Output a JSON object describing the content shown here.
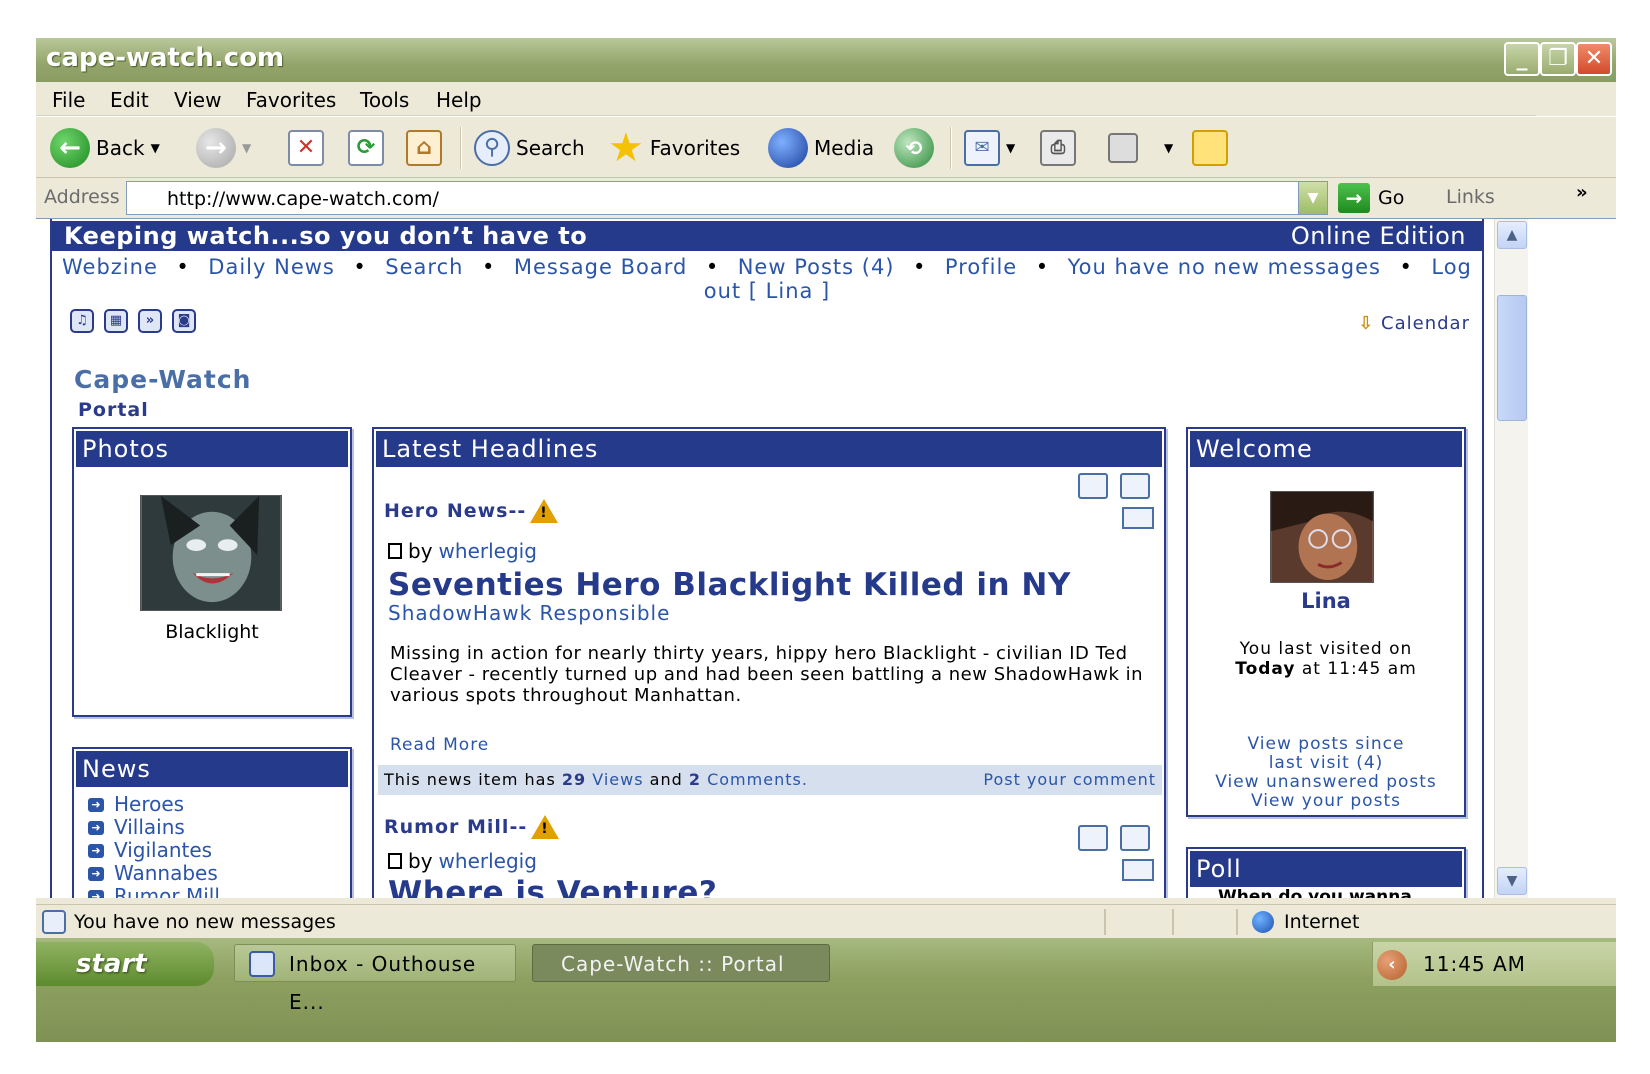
{
  "window": {
    "title": "cape-watch.com"
  },
  "menu": [
    "File",
    "Edit",
    "View",
    "Favorites",
    "Tools",
    "Help"
  ],
  "toolbar": {
    "back_label": "Back",
    "search_label": "Search",
    "favorites_label": "Favorites",
    "media_label": "Media"
  },
  "address": {
    "label": "Address",
    "url": "http://www.cape-watch.com/",
    "go_label": "Go",
    "links_label": "Links"
  },
  "site": {
    "slogan": "Keeping watch...so you don’t have to",
    "edition": "Online Edition",
    "nav": {
      "webzine": "Webzine",
      "daily_news": "Daily News",
      "search": "Search",
      "message_board": "Message Board",
      "new_posts": "New Posts (4)",
      "profile": "Profile",
      "no_messages": "You have no new messages",
      "log": "Log",
      "logout_rest": "out [  Lina   ]"
    },
    "calendar": "Calendar",
    "title": "Cape-Watch",
    "subtitle": "Portal"
  },
  "photos": {
    "header": "Photos",
    "caption": "Blacklight"
  },
  "news": {
    "header": "News",
    "items": [
      "Heroes",
      "Villains",
      "Vigilantes",
      "Wannabes",
      "Rumor Mill"
    ]
  },
  "headlines": {
    "header": "Latest Headlines",
    "article1": {
      "category": "Hero News--",
      "by": "by",
      "author": "wherlegig",
      "title": "Seventies Hero Blacklight Killed in NY",
      "subtitle": "ShadowHawk Responsible",
      "body": "Missing in action for nearly thirty years, hippy hero Blacklight - civilian ID Ted Cleaver - recently turned up and had been seen battling a new ShadowHawk in various spots throughout Manhattan.",
      "read_more": "Read More",
      "info_prefix": "This news item has",
      "views_count": "29",
      "views_label": "Views",
      "and": "and",
      "comments_count": "2",
      "comments_label": "Comments.",
      "post_comment": "Post your comment"
    },
    "article2": {
      "category": "Rumor Mill--",
      "by": "by",
      "author": "wherlegig",
      "title": "Where is Venture?"
    }
  },
  "welcome": {
    "header": "Welcome",
    "name": "Lina",
    "last_visited": "You last visited on",
    "today": "Today",
    "at": "at",
    "time": "11:45 am",
    "link_since_1": "View posts since",
    "link_since_2": "last visit (4)",
    "link_unanswered": "View unanswered posts",
    "link_yours": "View your posts"
  },
  "poll": {
    "header": "Poll",
    "question_partial": "When do you wanna"
  },
  "status": {
    "message": "You have no new messages",
    "zone": "Internet"
  },
  "taskbar": {
    "start": "start",
    "task_inbox": "Inbox - Outhouse E...",
    "task_portal": "Cape-Watch :: Portal",
    "clock": "11:45 AM"
  }
}
